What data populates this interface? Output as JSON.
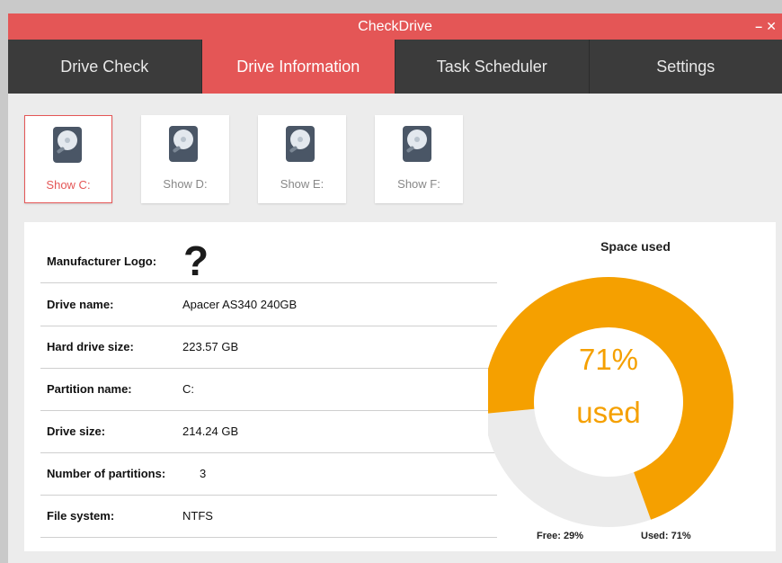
{
  "window": {
    "title": "CheckDrive",
    "min_glyph": "–",
    "close_glyph": "✕"
  },
  "tabs": [
    {
      "label": "Drive Check",
      "active": false
    },
    {
      "label": "Drive Information",
      "active": true
    },
    {
      "label": "Task Scheduler",
      "active": false
    },
    {
      "label": "Settings",
      "active": false
    }
  ],
  "drives": [
    {
      "label": "Show C:",
      "active": true,
      "icon": "hard-drive-icon"
    },
    {
      "label": "Show D:",
      "active": false,
      "icon": "hard-drive-icon"
    },
    {
      "label": "Show E:",
      "active": false,
      "icon": "hard-drive-icon"
    },
    {
      "label": "Show F:",
      "active": false,
      "icon": "hard-drive-icon"
    }
  ],
  "info": {
    "manufacturer_logo_label": "Manufacturer Logo:",
    "manufacturer_logo_glyph": "?",
    "drive_name_label": "Drive name:",
    "drive_name": "Apacer AS340 240GB",
    "hard_drive_size_label": "Hard drive size:",
    "hard_drive_size": "223.57 GB",
    "partition_name_label": "Partition name:",
    "partition_name": "C:",
    "drive_size_label": "Drive size:",
    "drive_size": "214.24 GB",
    "num_partitions_label": "Number of partitions:",
    "num_partitions": "3",
    "file_system_label": "File system:",
    "file_system": "NTFS"
  },
  "space": {
    "title": "Space used",
    "percent_text": "71%",
    "used_word": "used",
    "free_label": "Free: 29%",
    "used_label": "Used: 71%",
    "used_fraction": 0.71,
    "used_color": "#f5a000",
    "free_color": "#ebebeb"
  },
  "colors": {
    "accent": "#e45656",
    "tabbar": "#3b3b3b"
  }
}
